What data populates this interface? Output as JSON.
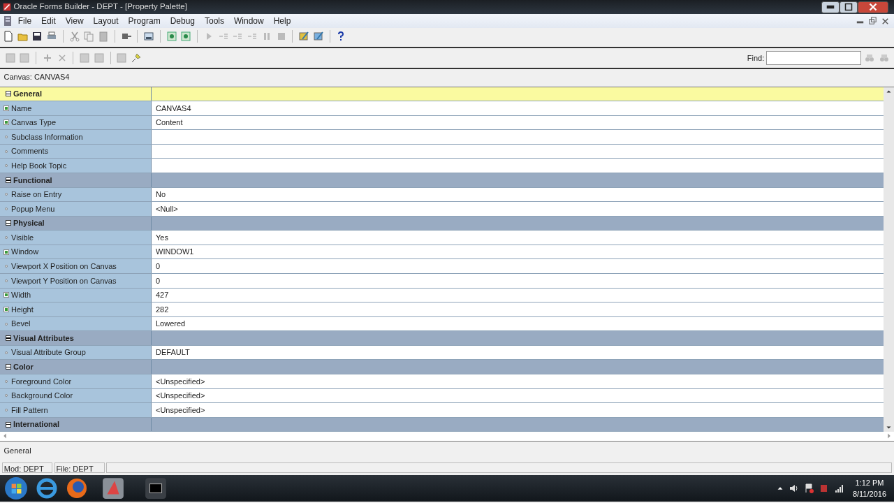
{
  "window": {
    "title": "Oracle Forms Builder - DEPT - [Property Palette]"
  },
  "menu": [
    "File",
    "Edit",
    "View",
    "Layout",
    "Program",
    "Debug",
    "Tools",
    "Window",
    "Help"
  ],
  "find": {
    "label": "Find:"
  },
  "object_label": "Canvas: CANVAS4",
  "properties": [
    {
      "kind": "category",
      "label": "General",
      "expanded": true,
      "selected": true
    },
    {
      "kind": "property",
      "label": "Name",
      "value": "CANVAS4",
      "changed": true
    },
    {
      "kind": "property",
      "label": "Canvas Type",
      "value": "Content",
      "changed": true
    },
    {
      "kind": "property",
      "label": "Subclass Information",
      "changed": false
    },
    {
      "kind": "property",
      "label": "Comments",
      "changed": false
    },
    {
      "kind": "property",
      "label": "Help Book Topic",
      "changed": false
    },
    {
      "kind": "category",
      "label": "Functional",
      "expanded": true,
      "selected": false
    },
    {
      "kind": "property",
      "label": "Raise on Entry",
      "value": "No",
      "changed": false
    },
    {
      "kind": "property",
      "label": "Popup Menu",
      "value": "<Null>",
      "changed": false
    },
    {
      "kind": "category",
      "label": "Physical",
      "expanded": true,
      "selected": false
    },
    {
      "kind": "property",
      "label": "Visible",
      "value": "Yes",
      "changed": false
    },
    {
      "kind": "property",
      "label": "Window",
      "value": "WINDOW1",
      "changed": true
    },
    {
      "kind": "property",
      "label": "Viewport X Position on Canvas",
      "value": "0",
      "changed": false
    },
    {
      "kind": "property",
      "label": "Viewport Y Position on Canvas",
      "value": "0",
      "changed": false
    },
    {
      "kind": "property",
      "label": "Width",
      "value": "427",
      "changed": true
    },
    {
      "kind": "property",
      "label": "Height",
      "value": "282",
      "changed": true
    },
    {
      "kind": "property",
      "label": "Bevel",
      "value": "Lowered",
      "changed": false
    },
    {
      "kind": "category",
      "label": "Visual Attributes",
      "expanded": true,
      "selected": false
    },
    {
      "kind": "property",
      "label": "Visual Attribute Group",
      "value": "DEFAULT",
      "changed": false
    },
    {
      "kind": "category",
      "label": "Color",
      "expanded": true,
      "selected": false
    },
    {
      "kind": "property",
      "label": "Foreground Color",
      "value": "<Unspecified>",
      "changed": false
    },
    {
      "kind": "property",
      "label": "Background Color",
      "value": "<Unspecified>",
      "changed": false
    },
    {
      "kind": "property",
      "label": "Fill Pattern",
      "value": "<Unspecified>",
      "changed": false
    },
    {
      "kind": "category",
      "label": "International",
      "expanded": true,
      "selected": false
    }
  ],
  "description": "General",
  "status_bar": [
    "Mod: DEPT",
    "File: DEPT"
  ],
  "taskbar": {
    "time": "1:12 PM",
    "date": "8/11/2016"
  }
}
